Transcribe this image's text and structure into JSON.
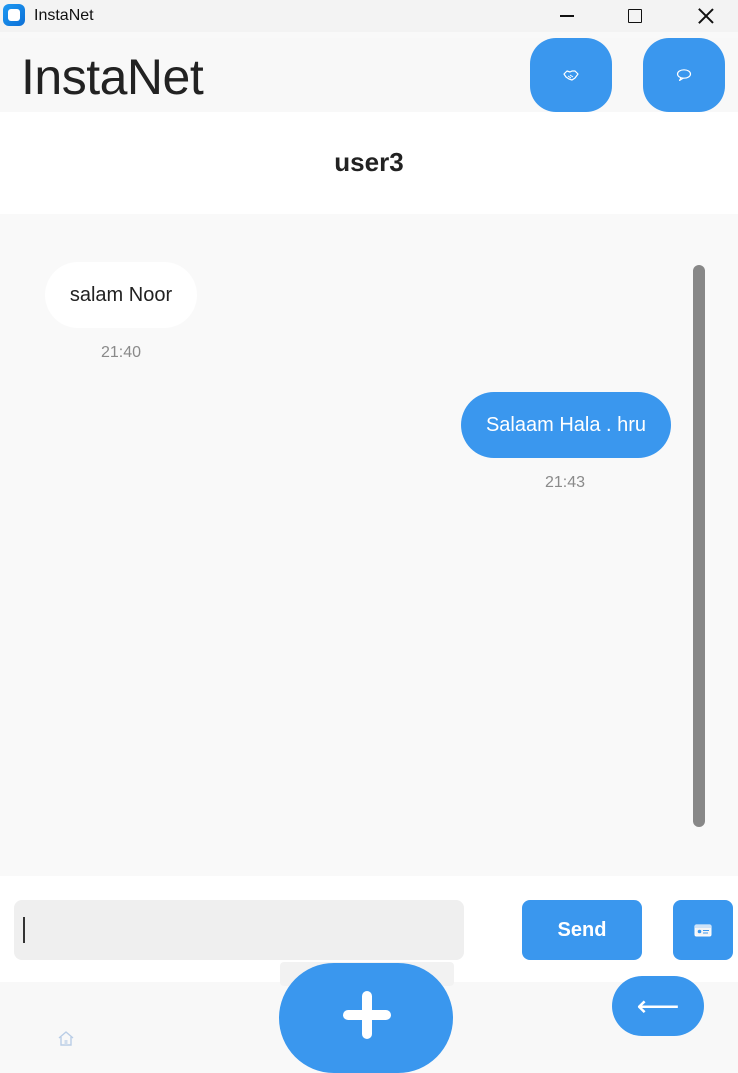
{
  "window": {
    "title": "InstaNet",
    "controls": {
      "minimize": "minimize-icon",
      "maximize": "maximize-icon",
      "close": "close-icon"
    }
  },
  "header": {
    "brand": "InstaNet",
    "buttons": [
      {
        "name": "friends",
        "icon": "handshake-icon"
      },
      {
        "name": "chat",
        "icon": "speech-bubble-icon"
      }
    ]
  },
  "chat": {
    "title": "user3",
    "messages": [
      {
        "direction": "incoming",
        "text": "salam Noor",
        "time": "21:40"
      },
      {
        "direction": "outgoing",
        "text": "Salaam Hala . hru",
        "time": "21:43"
      }
    ]
  },
  "composer": {
    "input_value": "",
    "send_label": "Send",
    "attach_icon": "id-card-icon"
  },
  "nav": {
    "home_icon": "home-icon",
    "add_icon": "plus-icon",
    "back_label": "⟵"
  },
  "colors": {
    "accent": "#3a97ee",
    "scrollbar": "#888888",
    "time_text": "#8a8a8a",
    "background": "#f9f9f9"
  }
}
